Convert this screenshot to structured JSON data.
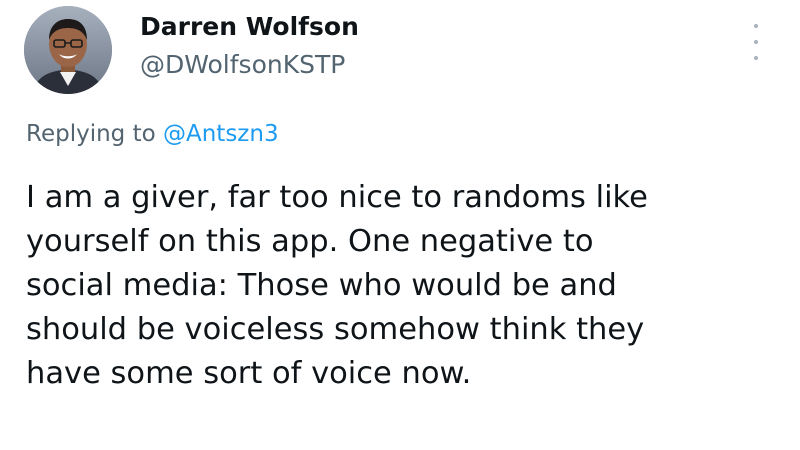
{
  "author": {
    "display_name": "Darren Wolfson",
    "handle": "@DWolfsonKSTP",
    "avatar_icon": "profile-photo"
  },
  "reply": {
    "prefix": "Replying to",
    "to_handle": "@Antszn3"
  },
  "tweet": {
    "lines": [
      "I am a giver, far too nice to randoms like",
      "yourself on this app. One negative to",
      "social media: Those who would be and",
      "should be voiceless somehow think they",
      "have some sort of voice now."
    ]
  },
  "menu": {
    "icon": "more-vertical-icon"
  },
  "colors": {
    "text": "#0f1419",
    "secondary": "#536471",
    "link": "#1d9bf0"
  }
}
